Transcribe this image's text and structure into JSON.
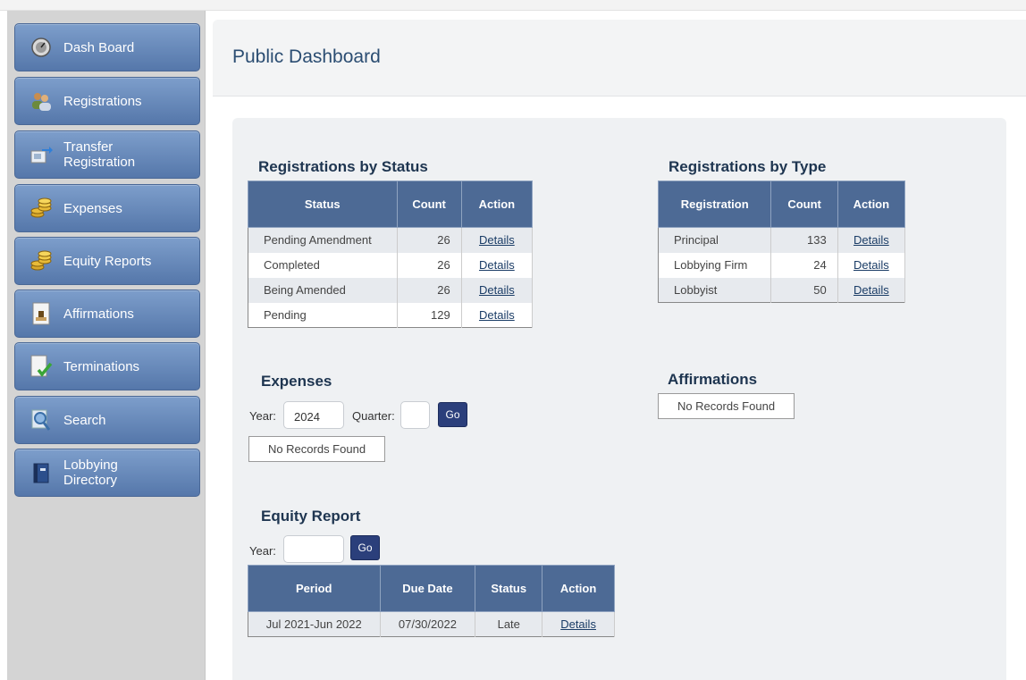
{
  "sidebar": {
    "items": [
      {
        "label": "Dash Board",
        "icon": "dashboard-gauge-icon"
      },
      {
        "label": "Registrations",
        "icon": "people-icon"
      },
      {
        "label_line1": "Transfer",
        "label_line2": "Registration",
        "icon": "transfer-icon"
      },
      {
        "label": "Expenses",
        "icon": "coins-icon"
      },
      {
        "label": "Equity Reports",
        "icon": "coins-icon"
      },
      {
        "label": "Affirmations",
        "icon": "stamp-document-icon"
      },
      {
        "label": "Terminations",
        "icon": "document-check-icon"
      },
      {
        "label": "Search",
        "icon": "search-magnifier-icon"
      },
      {
        "label_line1": "Lobbying",
        "label_line2": "Directory",
        "icon": "directory-book-icon"
      }
    ]
  },
  "header": {
    "title": "Public Dashboard"
  },
  "reg_by_status": {
    "title": "Registrations by Status",
    "headers": {
      "status": "Status",
      "count": "Count",
      "action": "Action"
    },
    "rows": [
      {
        "status": "Pending Amendment",
        "count": "26",
        "action": "Details"
      },
      {
        "status": "Completed",
        "count": "26",
        "action": "Details"
      },
      {
        "status": "Being Amended",
        "count": "26",
        "action": "Details"
      },
      {
        "status": "Pending",
        "count": "129",
        "action": "Details"
      }
    ]
  },
  "reg_by_type": {
    "title": "Registrations by Type",
    "headers": {
      "registration": "Registration",
      "count": "Count",
      "action": "Action"
    },
    "rows": [
      {
        "registration": "Principal",
        "count": "133",
        "action": "Details"
      },
      {
        "registration": "Lobbying Firm",
        "count": "24",
        "action": "Details"
      },
      {
        "registration": "Lobbyist",
        "count": "50",
        "action": "Details"
      }
    ]
  },
  "expenses": {
    "title": "Expenses",
    "year_label": "Year:",
    "year_value": "2024",
    "quarter_label": "Quarter:",
    "quarter_value": "",
    "go_label": "Go",
    "no_records": "No Records Found"
  },
  "affirmations": {
    "title": "Affirmations",
    "no_records": "No Records Found"
  },
  "equity_report": {
    "title": "Equity Report",
    "year_label": "Year:",
    "year_value": "",
    "go_label": "Go",
    "headers": {
      "period": "Period",
      "due_date": "Due Date",
      "status": "Status",
      "action": "Action"
    },
    "rows": [
      {
        "period": "Jul 2021-Jun 2022",
        "due_date": "07/30/2022",
        "status": "Late",
        "action": "Details"
      }
    ]
  },
  "colors": {
    "nav_button": "#5f80b2",
    "table_header": "#4d6a95",
    "go_button": "#2b3f7b",
    "title_text": "#2b4d72"
  }
}
